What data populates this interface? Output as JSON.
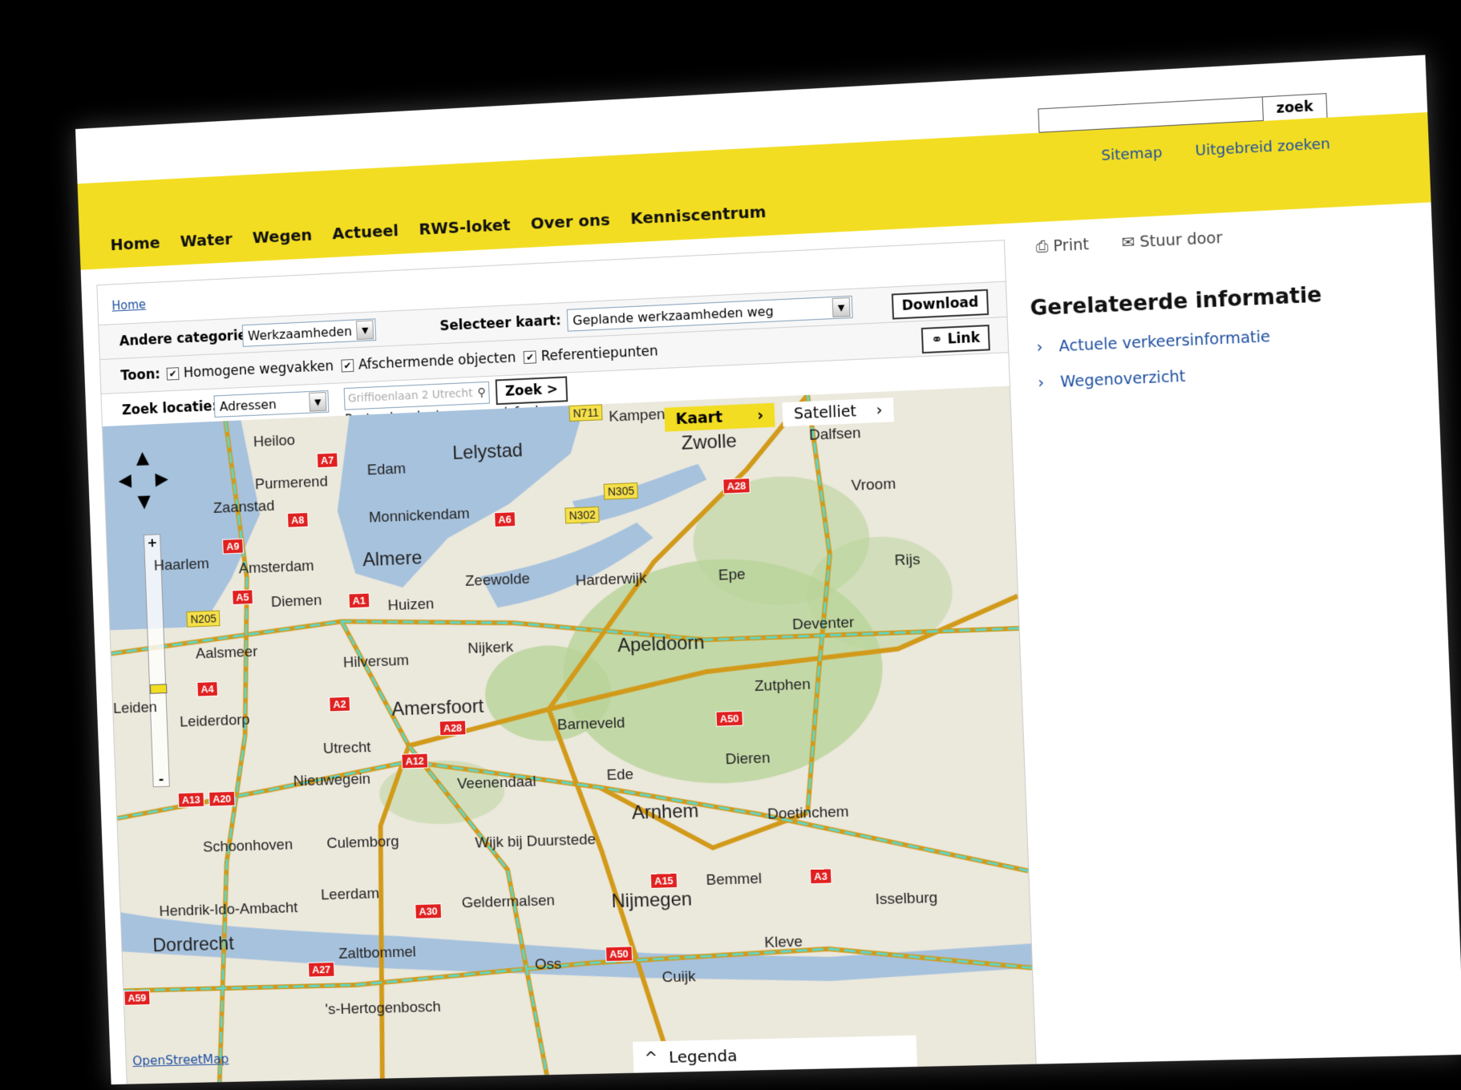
{
  "header": {
    "search_button": "zoek",
    "sitemap": "Sitemap",
    "advanced_search": "Uitgebreid zoeken",
    "nav": [
      "Home",
      "Water",
      "Wegen",
      "Actueel",
      "RWS-loket",
      "Over ons",
      "Kenniscentrum"
    ]
  },
  "breadcrumb": "Home",
  "controls": {
    "category_label": "Andere categorie:",
    "category_value": "Werkzaamheden",
    "map_select_label": "Selecteer kaart:",
    "map_select_value": "Geplande werkzaamheden weg",
    "download": "Download",
    "show_label": "Toon:",
    "checkboxes": [
      "Homogene wegvakken",
      "Afschermende objecten",
      "Referentiepunten"
    ],
    "link": "Link",
    "search_label": "Zoek locatie:",
    "search_type": "Adressen",
    "search_placeholder": "Griffioenlaan 2 Utrecht",
    "search_button": "Zoek >",
    "search_hint": "Postcode, plaatsnaam en/of adres"
  },
  "map": {
    "type_kaart": "Kaart",
    "type_satelliet": "Satelliet",
    "attribution": "OpenStreetMap",
    "legend": "Legenda",
    "places": [
      "Heiloo",
      "Purmerend",
      "Edam",
      "Lelystad",
      "Kampen",
      "Zwolle",
      "Dalfsen",
      "Zaanstad",
      "Monnickendam",
      "Vroom",
      "Haarlem",
      "Amsterdam",
      "Almere",
      "Zeewolde",
      "Harderwijk",
      "Epe",
      "Rijs",
      "Diemen",
      "Huizen",
      "Aalsmeer",
      "Hilversum",
      "Nijkerk",
      "Apeldoorn",
      "Deventer",
      "Leiden",
      "Leiderdorp",
      "Amersfoort",
      "Zutphen",
      "Barneveld",
      "Utrecht",
      "Nieuwegein",
      "Dieren",
      "Veenendaal",
      "Ede",
      "Arnhem",
      "Doetinchem",
      "Schoonhoven",
      "Culemborg",
      "Wijk bij Duurstede",
      "Leerdam",
      "Bemmel",
      "Hendrik-Ido-Ambacht",
      "Geldermalsen",
      "Nijmegen",
      "Isselburg",
      "Dordrecht",
      "Zaltbommel",
      "Kleve",
      "Oss",
      "Cuijk",
      "'s-Hertogenbosch"
    ],
    "road_shields": [
      "A7",
      "A6",
      "A28",
      "A8",
      "A9",
      "A5",
      "A1",
      "A4",
      "A2",
      "A12",
      "A28",
      "A50",
      "A13",
      "A20",
      "A30",
      "A15",
      "A3",
      "A27",
      "A50",
      "A59"
    ],
    "n_roads": [
      "N711",
      "N305",
      "N302",
      "N205"
    ]
  },
  "sidebar": {
    "print": "Print",
    "send": "Stuur door",
    "related_title": "Gerelateerde informatie",
    "related_items": [
      "Actuele verkeersinformatie",
      "Wegenoverzicht"
    ]
  }
}
